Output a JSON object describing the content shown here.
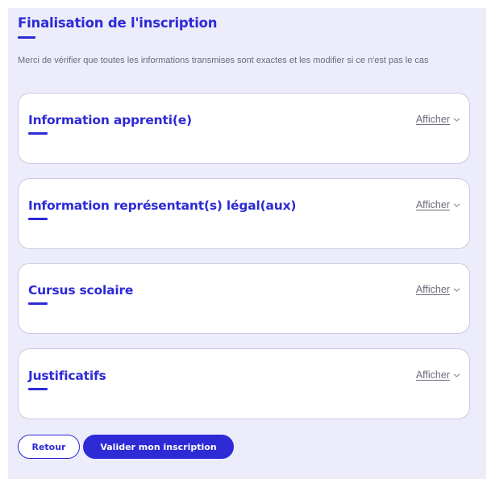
{
  "page": {
    "title": "Finalisation de l'inscription",
    "intro": "Merci de vérifier que toutes les informations transmises sont exactes et les modifier si ce n'est pas le cas"
  },
  "sections": [
    {
      "title": "Information apprenti(e)",
      "toggle_label": "Afficher",
      "expanded": false
    },
    {
      "title": "Information représentant(s) légal(aux)",
      "toggle_label": "Afficher",
      "expanded": false
    },
    {
      "title": "Cursus scolaire",
      "toggle_label": "Afficher",
      "expanded": false
    },
    {
      "title": "Justificatifs",
      "toggle_label": "Afficher",
      "expanded": false
    }
  ],
  "actions": {
    "back_label": "Retour",
    "submit_label": "Valider mon inscription"
  },
  "colors": {
    "accent": "#2d2ad6",
    "panel_background": "#ececfb",
    "muted_text": "#6b6b7b",
    "card_border": "#c9c9de"
  },
  "icons": {
    "toggle": "chevron-down-icon"
  }
}
